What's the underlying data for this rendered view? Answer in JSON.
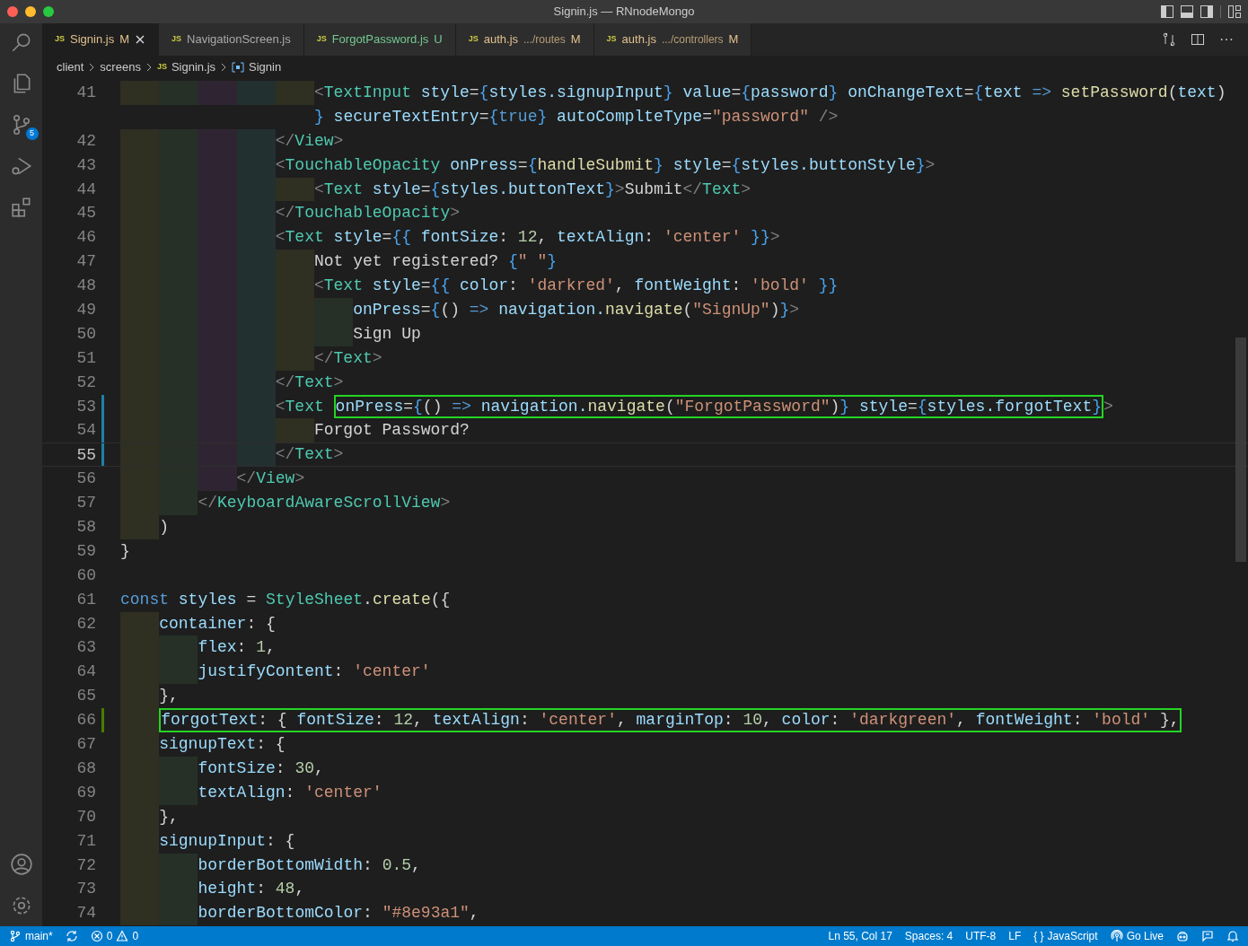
{
  "window": {
    "title": "Signin.js — RNnodeMongo"
  },
  "activity_bar": {
    "source_control_badge": "5"
  },
  "tabs": [
    {
      "icon_text": "JS",
      "label": "Signin.js",
      "status": "M",
      "color": "#e2c08d",
      "selected": true
    },
    {
      "icon_text": "JS",
      "label": "NavigationScreen.js",
      "color": "#a9a9a9",
      "selected": false
    },
    {
      "icon_text": "JS",
      "label": "ForgotPassword.js",
      "status": "U",
      "color": "#73c991",
      "selected": false
    },
    {
      "icon_text": "JS",
      "label": "auth.js",
      "description": ".../routes",
      "status": "M",
      "color": "#e2c08d",
      "selected": false
    },
    {
      "icon_text": "JS",
      "label": "auth.js",
      "description": ".../controllers",
      "status": "M",
      "color": "#e2c08d",
      "selected": false
    }
  ],
  "editor_actions": {
    "more": "···"
  },
  "breadcrumb": {
    "folders": [
      "client",
      "screens"
    ],
    "file_icon_text": "JS",
    "file": "Signin.js",
    "symbol": "Signin"
  },
  "code_lines": [
    {
      "number": "41",
      "indent_guides": [
        {
          "color": "#2f2f22"
        },
        {
          "color": "#263027"
        },
        {
          "color": "#2f2532"
        },
        {
          "color": "#233030"
        },
        {
          "color": "#2f2f22"
        }
      ],
      "segments": [
        {
          "boxed": false,
          "tokens": [
            {
              "kind": "punct",
              "text": "<"
            },
            {
              "kind": "tag",
              "text": "TextInput"
            },
            {
              "kind": "attr",
              "text": " style"
            },
            {
              "kind": "op",
              "text": "="
            },
            {
              "kind": "brace",
              "text": "{"
            },
            {
              "kind": "var",
              "text": "styles.signupInput"
            },
            {
              "kind": "brace",
              "text": "}"
            },
            {
              "kind": "attr",
              "text": " value"
            },
            {
              "kind": "op",
              "text": "="
            },
            {
              "kind": "brace",
              "text": "{"
            },
            {
              "kind": "var",
              "text": "password"
            },
            {
              "kind": "brace",
              "text": "}"
            },
            {
              "kind": "attr",
              "text": " onChangeText"
            },
            {
              "kind": "op",
              "text": "="
            },
            {
              "kind": "brace",
              "text": "{"
            },
            {
              "kind": "var",
              "text": "text "
            },
            {
              "kind": "kw",
              "text": "=>"
            },
            {
              "kind": "fn",
              "text": " setPassword"
            },
            {
              "kind": "text",
              "text": "("
            },
            {
              "kind": "var",
              "text": "text"
            },
            {
              "kind": "text",
              "text": ")"
            }
          ]
        }
      ]
    },
    {
      "continuation": true,
      "segments": [
        {
          "boxed": false,
          "tokens": [
            {
              "kind": "brace",
              "text": "}"
            },
            {
              "kind": "attr",
              "text": " secureTextEntry"
            },
            {
              "kind": "op",
              "text": "="
            },
            {
              "kind": "brace",
              "text": "{"
            },
            {
              "kind": "kw",
              "text": "true"
            },
            {
              "kind": "brace",
              "text": "}"
            },
            {
              "kind": "attr",
              "text": " autoComplteType"
            },
            {
              "kind": "op",
              "text": "="
            },
            {
              "kind": "str",
              "text": "\"password\""
            },
            {
              "kind": "punct",
              "text": " />"
            }
          ]
        }
      ]
    },
    {
      "number": "42",
      "indent_guides": [
        {
          "color": "#2f2f22"
        },
        {
          "color": "#263027"
        },
        {
          "color": "#2f2532"
        },
        {
          "color": "#233030"
        }
      ],
      "segments": [
        {
          "boxed": false,
          "tokens": [
            {
              "kind": "punct",
              "text": "</"
            },
            {
              "kind": "tag",
              "text": "View"
            },
            {
              "kind": "punct",
              "text": ">"
            }
          ]
        }
      ]
    },
    {
      "number": "43",
      "indent_guides": [
        {
          "color": "#2f2f22"
        },
        {
          "color": "#263027"
        },
        {
          "color": "#2f2532"
        },
        {
          "color": "#233030"
        }
      ],
      "segments": [
        {
          "boxed": false,
          "tokens": [
            {
              "kind": "punct",
              "text": "<"
            },
            {
              "kind": "tag",
              "text": "TouchableOpacity"
            },
            {
              "kind": "attr",
              "text": " onPress"
            },
            {
              "kind": "op",
              "text": "="
            },
            {
              "kind": "brace",
              "text": "{"
            },
            {
              "kind": "fn",
              "text": "handleSubmit"
            },
            {
              "kind": "brace",
              "text": "}"
            },
            {
              "kind": "attr",
              "text": " style"
            },
            {
              "kind": "op",
              "text": "="
            },
            {
              "kind": "brace",
              "text": "{"
            },
            {
              "kind": "var",
              "text": "styles.buttonStyle"
            },
            {
              "kind": "brace",
              "text": "}"
            },
            {
              "kind": "punct",
              "text": ">"
            }
          ]
        }
      ]
    },
    {
      "number": "44",
      "indent_guides": [
        {
          "color": "#2f2f22"
        },
        {
          "color": "#263027"
        },
        {
          "color": "#2f2532"
        },
        {
          "color": "#233030"
        },
        {
          "color": "#2f2f22"
        }
      ],
      "segments": [
        {
          "boxed": false,
          "tokens": [
            {
              "kind": "punct",
              "text": "<"
            },
            {
              "kind": "tag",
              "text": "Text"
            },
            {
              "kind": "attr",
              "text": " style"
            },
            {
              "kind": "op",
              "text": "="
            },
            {
              "kind": "brace",
              "text": "{"
            },
            {
              "kind": "var",
              "text": "styles.buttonText"
            },
            {
              "kind": "brace",
              "text": "}"
            },
            {
              "kind": "punct",
              "text": ">"
            },
            {
              "kind": "text",
              "text": "Submit"
            },
            {
              "kind": "punct",
              "text": "</"
            },
            {
              "kind": "tag",
              "text": "Text"
            },
            {
              "kind": "punct",
              "text": ">"
            }
          ]
        }
      ]
    },
    {
      "number": "45",
      "indent_guides": [
        {
          "color": "#2f2f22"
        },
        {
          "color": "#263027"
        },
        {
          "color": "#2f2532"
        },
        {
          "color": "#233030"
        }
      ],
      "segments": [
        {
          "boxed": false,
          "tokens": [
            {
              "kind": "punct",
              "text": "</"
            },
            {
              "kind": "tag",
              "text": "TouchableOpacity"
            },
            {
              "kind": "punct",
              "text": ">"
            }
          ]
        }
      ]
    },
    {
      "number": "46",
      "indent_guides": [
        {
          "color": "#2f2f22"
        },
        {
          "color": "#263027"
        },
        {
          "color": "#2f2532"
        },
        {
          "color": "#233030"
        }
      ],
      "segments": [
        {
          "boxed": false,
          "tokens": [
            {
              "kind": "punct",
              "text": "<"
            },
            {
              "kind": "tag",
              "text": "Text"
            },
            {
              "kind": "attr",
              "text": " style"
            },
            {
              "kind": "op",
              "text": "="
            },
            {
              "kind": "brace",
              "text": "{{"
            },
            {
              "kind": "attr",
              "text": " fontSize"
            },
            {
              "kind": "text",
              "text": ": "
            },
            {
              "kind": "num",
              "text": "12"
            },
            {
              "kind": "text",
              "text": ", "
            },
            {
              "kind": "attr",
              "text": "textAlign"
            },
            {
              "kind": "text",
              "text": ": "
            },
            {
              "kind": "str",
              "text": "'center'"
            },
            {
              "kind": "brace",
              "text": " }}"
            },
            {
              "kind": "punct",
              "text": ">"
            }
          ]
        }
      ]
    },
    {
      "number": "47",
      "indent_guides": [
        {
          "color": "#2f2f22"
        },
        {
          "color": "#263027"
        },
        {
          "color": "#2f2532"
        },
        {
          "color": "#233030"
        },
        {
          "color": "#2f2f22"
        }
      ],
      "segments": [
        {
          "boxed": false,
          "tokens": [
            {
              "kind": "text",
              "text": "Not yet registered? "
            },
            {
              "kind": "brace",
              "text": "{"
            },
            {
              "kind": "str",
              "text": "\" \""
            },
            {
              "kind": "brace",
              "text": "}"
            }
          ]
        }
      ]
    },
    {
      "number": "48",
      "indent_guides": [
        {
          "color": "#2f2f22"
        },
        {
          "color": "#263027"
        },
        {
          "color": "#2f2532"
        },
        {
          "color": "#233030"
        },
        {
          "color": "#2f2f22"
        }
      ],
      "segments": [
        {
          "boxed": false,
          "tokens": [
            {
              "kind": "punct",
              "text": "<"
            },
            {
              "kind": "tag",
              "text": "Text"
            },
            {
              "kind": "attr",
              "text": " style"
            },
            {
              "kind": "op",
              "text": "="
            },
            {
              "kind": "brace",
              "text": "{{"
            },
            {
              "kind": "attr",
              "text": " color"
            },
            {
              "kind": "text",
              "text": ": "
            },
            {
              "kind": "str",
              "text": "'darkred'"
            },
            {
              "kind": "text",
              "text": ", "
            },
            {
              "kind": "attr",
              "text": "fontWeight"
            },
            {
              "kind": "text",
              "text": ": "
            },
            {
              "kind": "str",
              "text": "'bold'"
            },
            {
              "kind": "brace",
              "text": " }}"
            }
          ]
        }
      ]
    },
    {
      "number": "49",
      "indent_guides": [
        {
          "color": "#2f2f22"
        },
        {
          "color": "#263027"
        },
        {
          "color": "#2f2532"
        },
        {
          "color": "#233030"
        },
        {
          "color": "#2f2f22"
        },
        {
          "color": "#263027"
        }
      ],
      "segments": [
        {
          "boxed": false,
          "tokens": [
            {
              "kind": "attr",
              "text": "onPress"
            },
            {
              "kind": "op",
              "text": "="
            },
            {
              "kind": "brace",
              "text": "{"
            },
            {
              "kind": "text",
              "text": "() "
            },
            {
              "kind": "kw",
              "text": "=>"
            },
            {
              "kind": "var",
              "text": " navigation."
            },
            {
              "kind": "fn",
              "text": "navigate"
            },
            {
              "kind": "text",
              "text": "("
            },
            {
              "kind": "str",
              "text": "\"SignUp\""
            },
            {
              "kind": "text",
              "text": ")"
            },
            {
              "kind": "brace",
              "text": "}"
            },
            {
              "kind": "punct",
              "text": ">"
            }
          ]
        }
      ]
    },
    {
      "number": "50",
      "indent_guides": [
        {
          "color": "#2f2f22"
        },
        {
          "color": "#263027"
        },
        {
          "color": "#2f2532"
        },
        {
          "color": "#233030"
        },
        {
          "color": "#2f2f22"
        },
        {
          "color": "#263027"
        }
      ],
      "segments": [
        {
          "boxed": false,
          "tokens": [
            {
              "kind": "text",
              "text": "Sign Up"
            }
          ]
        }
      ]
    },
    {
      "number": "51",
      "indent_guides": [
        {
          "color": "#2f2f22"
        },
        {
          "color": "#263027"
        },
        {
          "color": "#2f2532"
        },
        {
          "color": "#233030"
        },
        {
          "color": "#2f2f22"
        }
      ],
      "segments": [
        {
          "boxed": false,
          "tokens": [
            {
              "kind": "punct",
              "text": "</"
            },
            {
              "kind": "tag",
              "text": "Text"
            },
            {
              "kind": "punct",
              "text": ">"
            }
          ]
        }
      ]
    },
    {
      "number": "52",
      "indent_guides": [
        {
          "color": "#2f2f22"
        },
        {
          "color": "#263027"
        },
        {
          "color": "#2f2532"
        },
        {
          "color": "#233030"
        }
      ],
      "segments": [
        {
          "boxed": false,
          "tokens": [
            {
              "kind": "punct",
              "text": "</"
            },
            {
              "kind": "tag",
              "text": "Text"
            },
            {
              "kind": "punct",
              "text": ">"
            }
          ]
        }
      ]
    },
    {
      "number": "53",
      "indent_guides": [
        {
          "color": "#2f2f22"
        },
        {
          "color": "#263027"
        },
        {
          "color": "#2f2532"
        },
        {
          "color": "#233030"
        }
      ],
      "gutter": {
        "color": "#1b81a8"
      },
      "segments": [
        {
          "boxed": false,
          "tokens": [
            {
              "kind": "punct",
              "text": "<"
            },
            {
              "kind": "tag",
              "text": "Text "
            }
          ]
        },
        {
          "boxed": true,
          "tokens": [
            {
              "kind": "attr",
              "text": "onPress"
            },
            {
              "kind": "op",
              "text": "="
            },
            {
              "kind": "brace",
              "text": "{"
            },
            {
              "kind": "text",
              "text": "() "
            },
            {
              "kind": "kw",
              "text": "=>"
            },
            {
              "kind": "var",
              "text": " navigation."
            },
            {
              "kind": "fn",
              "text": "navigate"
            },
            {
              "kind": "text",
              "text": "("
            },
            {
              "kind": "str",
              "text": "\"ForgotPassword\""
            },
            {
              "kind": "text",
              "text": ")"
            },
            {
              "kind": "brace",
              "text": "}"
            },
            {
              "kind": "attr",
              "text": " style"
            },
            {
              "kind": "op",
              "text": "="
            },
            {
              "kind": "brace",
              "text": "{"
            },
            {
              "kind": "var",
              "text": "styles.forgotText"
            },
            {
              "kind": "brace",
              "text": "}"
            }
          ]
        },
        {
          "boxed": false,
          "tokens": [
            {
              "kind": "punct",
              "text": ">"
            }
          ]
        }
      ]
    },
    {
      "number": "54",
      "indent_guides": [
        {
          "color": "#2f2f22"
        },
        {
          "color": "#263027"
        },
        {
          "color": "#2f2532"
        },
        {
          "color": "#233030"
        },
        {
          "color": "#2f2f22"
        }
      ],
      "gutter": {
        "color": "#1b81a8"
      },
      "segments": [
        {
          "boxed": false,
          "tokens": [
            {
              "kind": "text",
              "text": "Forgot Password?"
            }
          ]
        }
      ]
    },
    {
      "number": "55",
      "indent_guides": [
        {
          "color": "#2f2f22"
        },
        {
          "color": "#263027"
        },
        {
          "color": "#2f2532"
        },
        {
          "color": "#233030"
        }
      ],
      "gutter": {
        "color": "#1b81a8"
      },
      "current": true,
      "segments": [
        {
          "boxed": false,
          "tokens": [
            {
              "kind": "punct",
              "text": "</"
            },
            {
              "kind": "tag",
              "text": "Text"
            },
            {
              "kind": "punct",
              "text": ">"
            }
          ]
        }
      ]
    },
    {
      "number": "56",
      "indent_guides": [
        {
          "color": "#2f2f22"
        },
        {
          "color": "#263027"
        },
        {
          "color": "#2f2532"
        }
      ],
      "segments": [
        {
          "boxed": false,
          "tokens": [
            {
              "kind": "punct",
              "text": "</"
            },
            {
              "kind": "tag",
              "text": "View"
            },
            {
              "kind": "punct",
              "text": ">"
            }
          ]
        }
      ]
    },
    {
      "number": "57",
      "indent_guides": [
        {
          "color": "#2f2f22"
        },
        {
          "color": "#263027"
        }
      ],
      "segments": [
        {
          "boxed": false,
          "tokens": [
            {
              "kind": "punct",
              "text": "</"
            },
            {
              "kind": "tag",
              "text": "KeyboardAwareScrollView"
            },
            {
              "kind": "punct",
              "text": ">"
            }
          ]
        }
      ]
    },
    {
      "number": "58",
      "indent_guides": [
        {
          "color": "#2f2f22"
        }
      ],
      "segments": [
        {
          "boxed": false,
          "tokens": [
            {
              "kind": "text",
              "text": ")"
            }
          ]
        }
      ]
    },
    {
      "number": "59",
      "segments": [
        {
          "boxed": false,
          "tokens": [
            {
              "kind": "text",
              "text": "}"
            }
          ]
        }
      ]
    },
    {
      "number": "60"
    },
    {
      "number": "61",
      "segments": [
        {
          "boxed": false,
          "tokens": [
            {
              "kind": "kw",
              "text": "const"
            },
            {
              "kind": "var",
              "text": " styles"
            },
            {
              "kind": "op",
              "text": " = "
            },
            {
              "kind": "class",
              "text": "StyleSheet"
            },
            {
              "kind": "text",
              "text": "."
            },
            {
              "kind": "fn",
              "text": "create"
            },
            {
              "kind": "text",
              "text": "({"
            }
          ]
        }
      ]
    },
    {
      "number": "62",
      "indent_guides": [
        {
          "color": "#2f2f22"
        }
      ],
      "segments": [
        {
          "boxed": false,
          "tokens": [
            {
              "kind": "attr",
              "text": "container"
            },
            {
              "kind": "text",
              "text": ": {"
            }
          ]
        }
      ]
    },
    {
      "number": "63",
      "indent_guides": [
        {
          "color": "#2f2f22"
        },
        {
          "color": "#263027"
        }
      ],
      "segments": [
        {
          "boxed": false,
          "tokens": [
            {
              "kind": "attr",
              "text": "flex"
            },
            {
              "kind": "text",
              "text": ": "
            },
            {
              "kind": "num",
              "text": "1"
            },
            {
              "kind": "text",
              "text": ","
            }
          ]
        }
      ]
    },
    {
      "number": "64",
      "indent_guides": [
        {
          "color": "#2f2f22"
        },
        {
          "color": "#263027"
        }
      ],
      "segments": [
        {
          "boxed": false,
          "tokens": [
            {
              "kind": "attr",
              "text": "justifyContent"
            },
            {
              "kind": "text",
              "text": ": "
            },
            {
              "kind": "str",
              "text": "'center'"
            }
          ]
        }
      ]
    },
    {
      "number": "65",
      "indent_guides": [
        {
          "color": "#2f2f22"
        }
      ],
      "segments": [
        {
          "boxed": false,
          "tokens": [
            {
              "kind": "text",
              "text": "},"
            }
          ]
        }
      ]
    },
    {
      "number": "66",
      "indent_guides": [
        {
          "color": "#2f2f22"
        }
      ],
      "gutter": {
        "color": "#487e02"
      },
      "segments": [
        {
          "boxed": true,
          "tokens": [
            {
              "kind": "attr",
              "text": "forgotText"
            },
            {
              "kind": "text",
              "text": ": { "
            },
            {
              "kind": "attr",
              "text": "fontSize"
            },
            {
              "kind": "text",
              "text": ": "
            },
            {
              "kind": "num",
              "text": "12"
            },
            {
              "kind": "text",
              "text": ", "
            },
            {
              "kind": "attr",
              "text": "textAlign"
            },
            {
              "kind": "text",
              "text": ": "
            },
            {
              "kind": "str",
              "text": "'center'"
            },
            {
              "kind": "text",
              "text": ", "
            },
            {
              "kind": "attr",
              "text": "marginTop"
            },
            {
              "kind": "text",
              "text": ": "
            },
            {
              "kind": "num",
              "text": "10"
            },
            {
              "kind": "text",
              "text": ", "
            },
            {
              "kind": "attr",
              "text": "color"
            },
            {
              "kind": "text",
              "text": ": "
            },
            {
              "kind": "str",
              "text": "'darkgreen'"
            },
            {
              "kind": "text",
              "text": ", "
            },
            {
              "kind": "attr",
              "text": "fontWeight"
            },
            {
              "kind": "text",
              "text": ": "
            },
            {
              "kind": "str",
              "text": "'bold'"
            },
            {
              "kind": "text",
              "text": " },"
            }
          ]
        }
      ]
    },
    {
      "number": "67",
      "indent_guides": [
        {
          "color": "#2f2f22"
        }
      ],
      "segments": [
        {
          "boxed": false,
          "tokens": [
            {
              "kind": "attr",
              "text": "signupText"
            },
            {
              "kind": "text",
              "text": ": {"
            }
          ]
        }
      ]
    },
    {
      "number": "68",
      "indent_guides": [
        {
          "color": "#2f2f22"
        },
        {
          "color": "#263027"
        }
      ],
      "segments": [
        {
          "boxed": false,
          "tokens": [
            {
              "kind": "attr",
              "text": "fontSize"
            },
            {
              "kind": "text",
              "text": ": "
            },
            {
              "kind": "num",
              "text": "30"
            },
            {
              "kind": "text",
              "text": ","
            }
          ]
        }
      ]
    },
    {
      "number": "69",
      "indent_guides": [
        {
          "color": "#2f2f22"
        },
        {
          "color": "#263027"
        }
      ],
      "segments": [
        {
          "boxed": false,
          "tokens": [
            {
              "kind": "attr",
              "text": "textAlign"
            },
            {
              "kind": "text",
              "text": ": "
            },
            {
              "kind": "str",
              "text": "'center'"
            }
          ]
        }
      ]
    },
    {
      "number": "70",
      "indent_guides": [
        {
          "color": "#2f2f22"
        }
      ],
      "segments": [
        {
          "boxed": false,
          "tokens": [
            {
              "kind": "text",
              "text": "},"
            }
          ]
        }
      ]
    },
    {
      "number": "71",
      "indent_guides": [
        {
          "color": "#2f2f22"
        }
      ],
      "segments": [
        {
          "boxed": false,
          "tokens": [
            {
              "kind": "attr",
              "text": "signupInput"
            },
            {
              "kind": "text",
              "text": ": {"
            }
          ]
        }
      ]
    },
    {
      "number": "72",
      "indent_guides": [
        {
          "color": "#2f2f22"
        },
        {
          "color": "#263027"
        }
      ],
      "segments": [
        {
          "boxed": false,
          "tokens": [
            {
              "kind": "attr",
              "text": "borderBottomWidth"
            },
            {
              "kind": "text",
              "text": ": "
            },
            {
              "kind": "num",
              "text": "0.5"
            },
            {
              "kind": "text",
              "text": ","
            }
          ]
        }
      ]
    },
    {
      "number": "73",
      "indent_guides": [
        {
          "color": "#2f2f22"
        },
        {
          "color": "#263027"
        }
      ],
      "segments": [
        {
          "boxed": false,
          "tokens": [
            {
              "kind": "attr",
              "text": "height"
            },
            {
              "kind": "text",
              "text": ": "
            },
            {
              "kind": "num",
              "text": "48"
            },
            {
              "kind": "text",
              "text": ","
            }
          ]
        }
      ]
    },
    {
      "number": "74",
      "indent_guides": [
        {
          "color": "#2f2f22"
        },
        {
          "color": "#263027"
        }
      ],
      "segments": [
        {
          "boxed": false,
          "tokens": [
            {
              "kind": "attr",
              "text": "borderBottomColor"
            },
            {
              "kind": "text",
              "text": ": "
            },
            {
              "kind": "str",
              "text": "\"#8e93a1\""
            },
            {
              "kind": "text",
              "text": ","
            }
          ]
        }
      ]
    }
  ],
  "status_bar": {
    "branch": "main*",
    "errors": "0",
    "warnings": "0",
    "position": "Ln 55, Col 17",
    "spaces": "Spaces: 4",
    "encoding": "UTF-8",
    "eol": "LF",
    "language_icon_text": "{ }",
    "language": "JavaScript",
    "go_live": "Go Live"
  }
}
